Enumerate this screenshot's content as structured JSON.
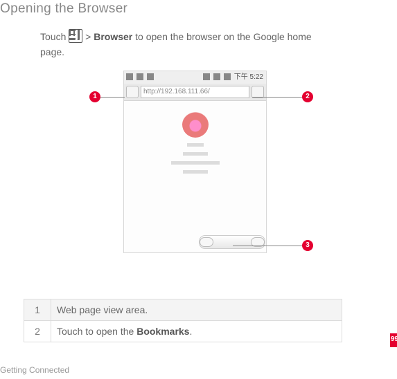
{
  "heading": "Opening the Browser",
  "intro_pre": "Touch ",
  "intro_mid": " > ",
  "intro_bold": "Browser",
  "intro_post": " to open the browser on the Google home page.",
  "phone": {
    "time": "下午 5:22",
    "url": "http://192.168.111.66/"
  },
  "callouts": {
    "c1": "1",
    "c2": "2",
    "c3": "3"
  },
  "table": {
    "r1n": "1",
    "r1t": "Web page view area.",
    "r2n": "2",
    "r2t_pre": "Touch to open the ",
    "r2t_bold": "Bookmarks",
    "r2t_post": "."
  },
  "footer": "Getting Connected",
  "pagenum": "99"
}
